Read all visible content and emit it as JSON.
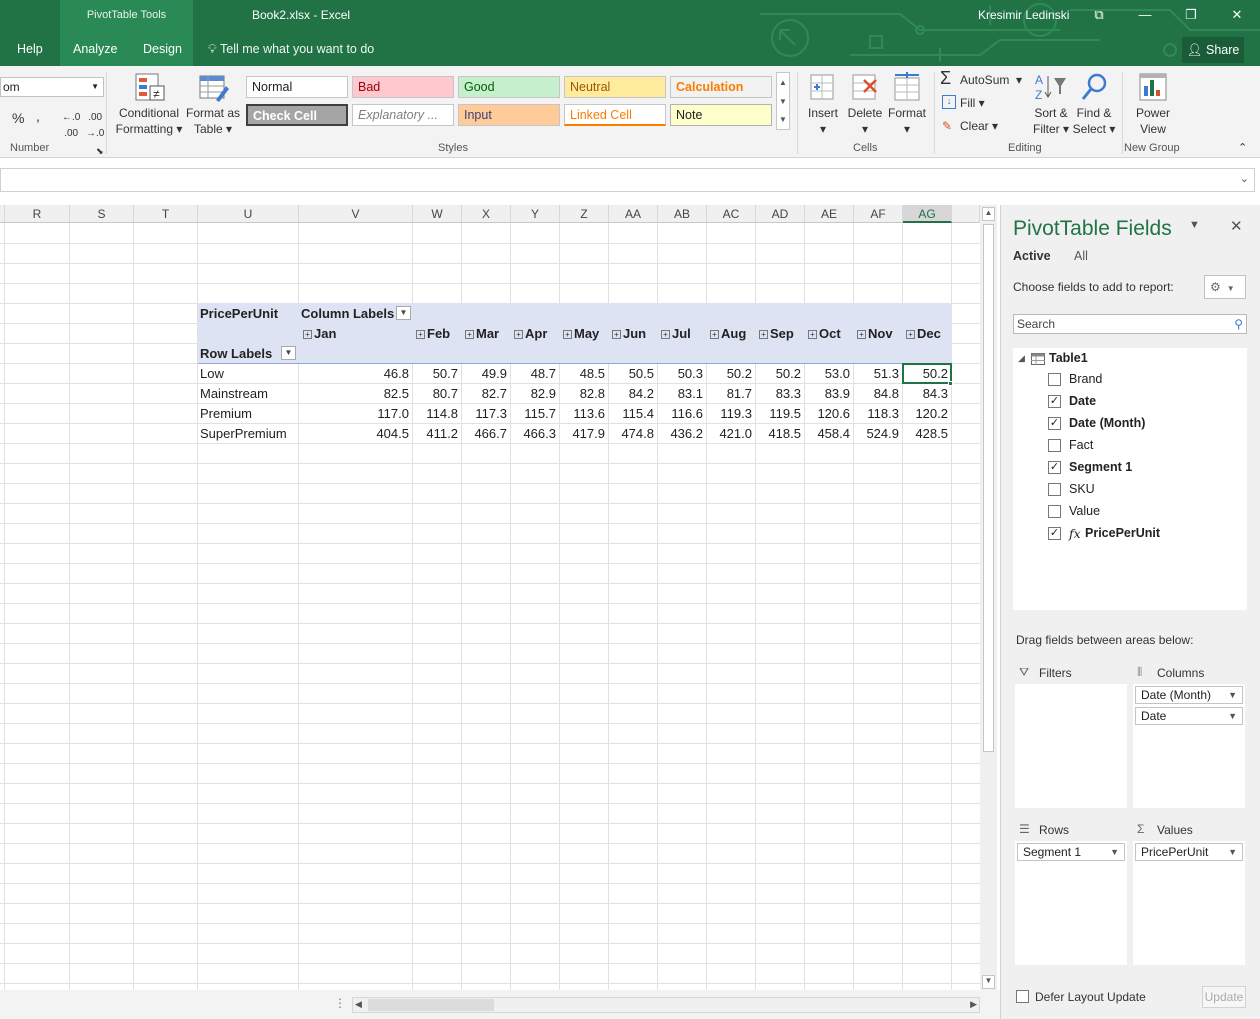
{
  "title_bar": {
    "context_tab": "PivotTable Tools",
    "document": "Book2.xlsx  -  Excel",
    "user": "Kresimir Ledinski",
    "share": "Share",
    "tell_me": "Tell me what you want to do",
    "tabs": [
      "Help",
      "Analyze",
      "Design"
    ]
  },
  "ribbon": {
    "number_format": "om",
    "number_group": "Number",
    "percent": "%",
    "comma": ",",
    "conditional_formatting": [
      "Conditional",
      "Formatting ▾"
    ],
    "format_as_table": [
      "Format as",
      "Table ▾"
    ],
    "styles_group": "Styles",
    "styles": [
      {
        "label": "Normal",
        "bg": "#ffffff",
        "fg": "#222222"
      },
      {
        "label": "Bad",
        "bg": "#ffc7ce",
        "fg": "#9c0006"
      },
      {
        "label": "Good",
        "bg": "#c6efce",
        "fg": "#006100"
      },
      {
        "label": "Neutral",
        "bg": "#ffeb9c",
        "fg": "#9c5700"
      },
      {
        "label": "Calculation",
        "bg": "#f2f2f2",
        "fg": "#fa7d00"
      },
      {
        "label": "Check Cell",
        "bg": "#a5a5a5",
        "fg": "#ffffff"
      },
      {
        "label": "Explanatory ...",
        "bg": "#ffffff",
        "fg": "#7f7f7f"
      },
      {
        "label": "Input",
        "bg": "#ffcc99",
        "fg": "#3f3f76"
      },
      {
        "label": "Linked Cell",
        "bg": "#ffffff",
        "fg": "#fa7d00"
      },
      {
        "label": "Note",
        "bg": "#ffffcc",
        "fg": "#222222"
      }
    ],
    "cells_group": "Cells",
    "insert": "Insert",
    "delete": "Delete",
    "format": "Format",
    "editing_group": "Editing",
    "autosum": "AutoSum",
    "fill": "Fill",
    "clear": "Clear",
    "sort_filter": [
      "Sort &",
      "Filter ▾"
    ],
    "find_select": [
      "Find &",
      "Select ▾"
    ],
    "power_view": [
      "Power",
      "View"
    ],
    "new_group": "New Group"
  },
  "columns": [
    "R",
    "S",
    "T",
    "U",
    "V",
    "W",
    "X",
    "Y",
    "Z",
    "AA",
    "AB",
    "AC",
    "AD",
    "AE",
    "AF",
    "AG"
  ],
  "pivot": {
    "value_field": "PricePerUnit",
    "column_labels": "Column Labels",
    "row_labels": "Row Labels",
    "months": [
      "Jan",
      "Feb",
      "Mar",
      "Apr",
      "May",
      "Jun",
      "Jul",
      "Aug",
      "Sep",
      "Oct",
      "Nov",
      "Dec"
    ],
    "rows": [
      {
        "label": "Low",
        "values": [
          "46.8",
          "50.7",
          "49.9",
          "48.7",
          "48.5",
          "50.5",
          "50.3",
          "50.2",
          "50.2",
          "53.0",
          "51.3",
          "50.2"
        ]
      },
      {
        "label": "Mainstream",
        "values": [
          "82.5",
          "80.7",
          "82.7",
          "82.9",
          "82.8",
          "84.2",
          "83.1",
          "81.7",
          "83.3",
          "83.9",
          "84.8",
          "84.3"
        ]
      },
      {
        "label": "Premium",
        "values": [
          "117.0",
          "114.8",
          "117.3",
          "115.7",
          "113.6",
          "115.4",
          "116.6",
          "119.3",
          "119.5",
          "120.6",
          "118.3",
          "120.2"
        ]
      },
      {
        "label": "SuperPremium",
        "values": [
          "404.5",
          "411.2",
          "466.7",
          "466.3",
          "417.9",
          "474.8",
          "436.2",
          "421.0",
          "418.5",
          "458.4",
          "524.9",
          "428.5"
        ]
      }
    ]
  },
  "pane": {
    "title": "PivotTable Fields",
    "tab_active": "Active",
    "tab_all": "All",
    "choose": "Choose fields to add to report:",
    "search_placeholder": "Search",
    "table": "Table1",
    "fields": [
      {
        "label": "Brand",
        "checked": false
      },
      {
        "label": "Date",
        "checked": true
      },
      {
        "label": "Date (Month)",
        "checked": true
      },
      {
        "label": "Fact",
        "checked": false
      },
      {
        "label": "Segment 1",
        "checked": true
      },
      {
        "label": "SKU",
        "checked": false
      },
      {
        "label": "Value",
        "checked": false
      },
      {
        "label": "PricePerUnit",
        "checked": true
      }
    ],
    "fx": "fx",
    "drag_hint": "Drag fields between areas below:",
    "filters": "Filters",
    "columns": "Columns",
    "rows": "Rows",
    "values": "Values",
    "columns_items": [
      "Date (Month)",
      "Date"
    ],
    "rows_items": [
      "Segment 1"
    ],
    "values_items": [
      "PricePerUnit"
    ],
    "defer": "Defer Layout Update",
    "update": "Update"
  }
}
